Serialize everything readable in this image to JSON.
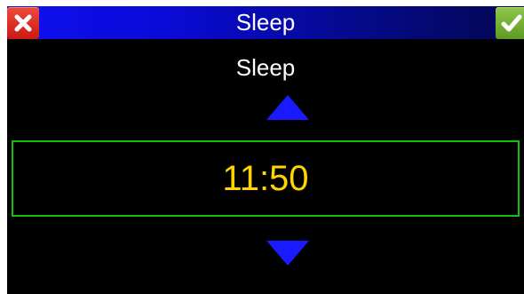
{
  "dialog": {
    "title": "Sleep",
    "close_icon": "close-icon",
    "confirm_icon": "checkmark-icon"
  },
  "setting": {
    "label": "Sleep",
    "value": "11:50",
    "increase_icon": "triangle-up-icon",
    "decrease_icon": "triangle-down-icon"
  },
  "colors": {
    "title_bar": "#0a0ad8",
    "background": "#000000",
    "value_text": "#ffd400",
    "value_border": "#12c012",
    "arrow": "#1a1aff",
    "close_button": "#d62b1f",
    "confirm_button": "#76b536"
  }
}
